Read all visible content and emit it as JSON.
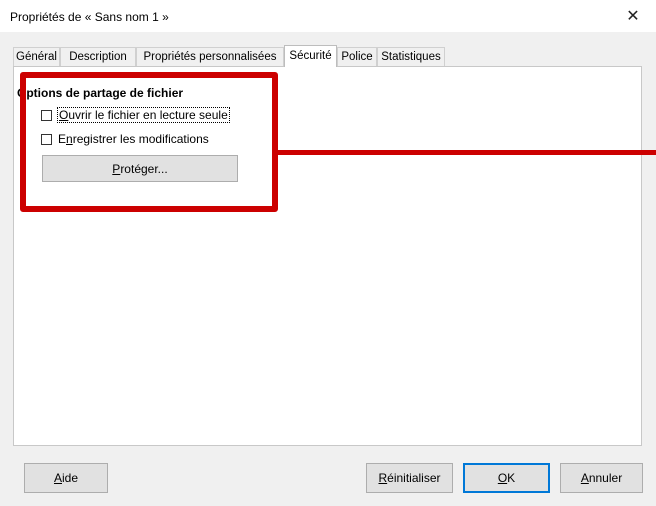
{
  "window": {
    "title": "Propriétés de « Sans nom 1 »",
    "close_glyph": "✕"
  },
  "tabs": [
    {
      "label": "Général",
      "active": false
    },
    {
      "label": "Description",
      "active": false
    },
    {
      "label": "Propriétés personnalisées",
      "active": false
    },
    {
      "label": "Sécurité",
      "active": true
    },
    {
      "label": "Police",
      "active": false
    },
    {
      "label": "Statistiques",
      "active": false
    }
  ],
  "security": {
    "section_title": "Options de partage de fichier",
    "checkboxes": [
      {
        "mnemonic": "O",
        "rest": "uvrir le fichier en lecture seule",
        "checked": false
      },
      {
        "pre": "E",
        "mnemonic": "n",
        "rest": "registrer les modifications",
        "checked": false
      }
    ],
    "protect_button": {
      "mnemonic": "P",
      "rest": "rotéger..."
    }
  },
  "footer": {
    "help": {
      "mnemonic": "A",
      "rest": "ide"
    },
    "reset": {
      "mnemonic": "R",
      "rest": "éinitialiser"
    },
    "ok": {
      "mnemonic": "O",
      "rest": "K"
    },
    "cancel": {
      "mnemonic": "A",
      "rest": "nnuler"
    }
  },
  "colors": {
    "highlight": "#cc0000",
    "default_button_border": "#0078d7"
  }
}
